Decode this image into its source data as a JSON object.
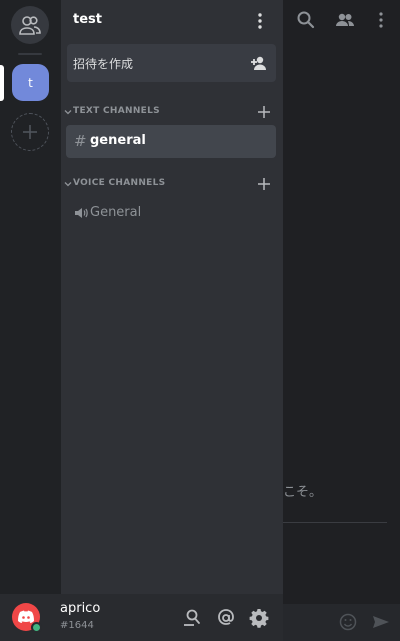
{
  "server": {
    "name": "test",
    "guild_initial": "t"
  },
  "invite": {
    "label": "招待を作成"
  },
  "categories": [
    {
      "label": "TEXT CHANNELS"
    },
    {
      "label": "VOICE CHANNELS"
    }
  ],
  "channels": {
    "text": [
      {
        "name": "general",
        "selected": true
      }
    ],
    "voice": [
      {
        "name": "General"
      }
    ]
  },
  "chat_background": {
    "welcome_fragment": "こそ。"
  },
  "user": {
    "name": "aprico",
    "discriminator": "#1644",
    "status": "online"
  },
  "icons": {
    "home": "friends-icon",
    "add_server": "plus-icon",
    "server_menu": "kebab-icon",
    "invite": "add-person-icon",
    "text_channel": "hash-icon",
    "voice_channel": "speaker-icon",
    "user_actions": [
      "search-icon",
      "mention-icon",
      "gear-icon"
    ]
  },
  "colors": {
    "accent": "#7289da",
    "online": "#43b581",
    "avatar": "#f04747"
  }
}
